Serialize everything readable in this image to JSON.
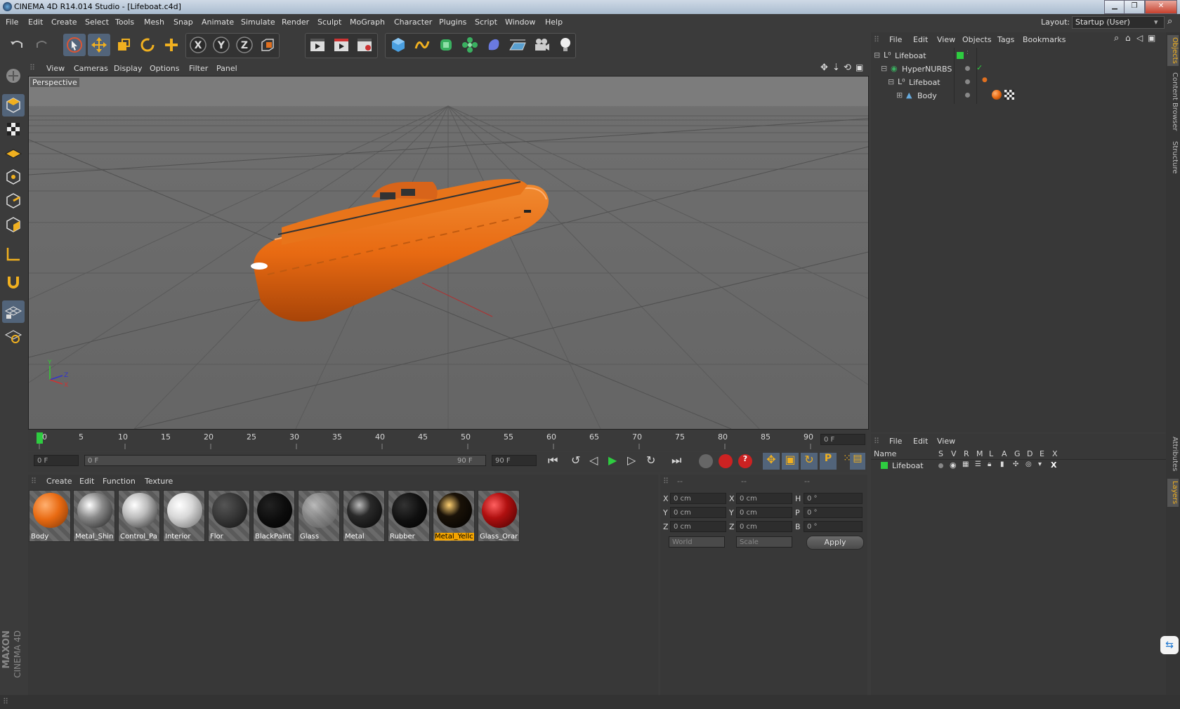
{
  "window": {
    "title": "CINEMA 4D R14.014 Studio - [Lifeboat.c4d]"
  },
  "menu": [
    "File",
    "Edit",
    "Create",
    "Select",
    "Tools",
    "Mesh",
    "Snap",
    "Animate",
    "Simulate",
    "Render",
    "Sculpt",
    "MoGraph",
    "Character",
    "Plugins",
    "Script",
    "Window",
    "Help"
  ],
  "layout": {
    "label": "Layout:",
    "value": "Startup (User)"
  },
  "viewport_menu": [
    "View",
    "Cameras",
    "Display",
    "Options",
    "Filter",
    "Panel"
  ],
  "viewport_label": "Perspective",
  "timeline": {
    "ticks": [
      "0",
      "5",
      "10",
      "15",
      "20",
      "25",
      "30",
      "35",
      "40",
      "45",
      "50",
      "55",
      "60",
      "65",
      "70",
      "75",
      "80",
      "85",
      "90"
    ],
    "current_frame": "0 F"
  },
  "playback": {
    "start": "0 F",
    "range_start": "0 F",
    "range_end": "90 F",
    "end": "90 F"
  },
  "material_menu": [
    "Create",
    "Edit",
    "Function",
    "Texture"
  ],
  "materials": [
    {
      "name": "Body",
      "color": "#e86a12"
    },
    {
      "name": "Metal_Shin",
      "color": "#8a8a8a"
    },
    {
      "name": "Control_Pa",
      "color": "#bbbbbb"
    },
    {
      "name": "Interior",
      "color": "#d8d8d8"
    },
    {
      "name": "Flor",
      "color": "#3a3a3a"
    },
    {
      "name": "BlackPaint",
      "color": "#0c0c0c"
    },
    {
      "name": "Glass",
      "color": "#9a9a9a"
    },
    {
      "name": "Metal",
      "color": "#2a2a2a"
    },
    {
      "name": "Rubber",
      "color": "#0f0f0f"
    },
    {
      "name": "Metal_Yellc",
      "color": "#1a1208"
    },
    {
      "name": "Glass_Orar",
      "color": "#b01010"
    }
  ],
  "coords": {
    "headers": [
      "--",
      "--",
      "--"
    ],
    "rows": [
      {
        "a": "X",
        "av": "0 cm",
        "b": "X",
        "bv": "0 cm",
        "c": "H",
        "cv": "0 °"
      },
      {
        "a": "Y",
        "av": "0 cm",
        "b": "Y",
        "bv": "0 cm",
        "c": "P",
        "cv": "0 °"
      },
      {
        "a": "Z",
        "av": "0 cm",
        "b": "Z",
        "bv": "0 cm",
        "c": "B",
        "cv": "0 °"
      }
    ],
    "world": "World",
    "scale": "Scale",
    "apply": "Apply"
  },
  "object_manager": {
    "menu": [
      "File",
      "Edit",
      "View",
      "Objects",
      "Tags",
      "Bookmarks"
    ],
    "objects": [
      {
        "name": "Lifeboat",
        "indent": 0
      },
      {
        "name": "HyperNURBS",
        "indent": 1
      },
      {
        "name": "Lifeboat",
        "indent": 2
      },
      {
        "name": "Body",
        "indent": 3
      }
    ]
  },
  "layer_manager": {
    "menu": [
      "File",
      "Edit",
      "View"
    ],
    "columns": [
      "Name",
      "S",
      "V",
      "R",
      "M",
      "L",
      "A",
      "G",
      "D",
      "E",
      "X"
    ],
    "layers": [
      {
        "name": "Lifeboat",
        "color": "#33cc33"
      }
    ]
  },
  "side_tabs": [
    "Objects",
    "Content Browser",
    "Structure",
    "Attributes",
    "Layers"
  ],
  "brand": {
    "maxon": "MAXON",
    "product": "CINEMA 4D"
  }
}
